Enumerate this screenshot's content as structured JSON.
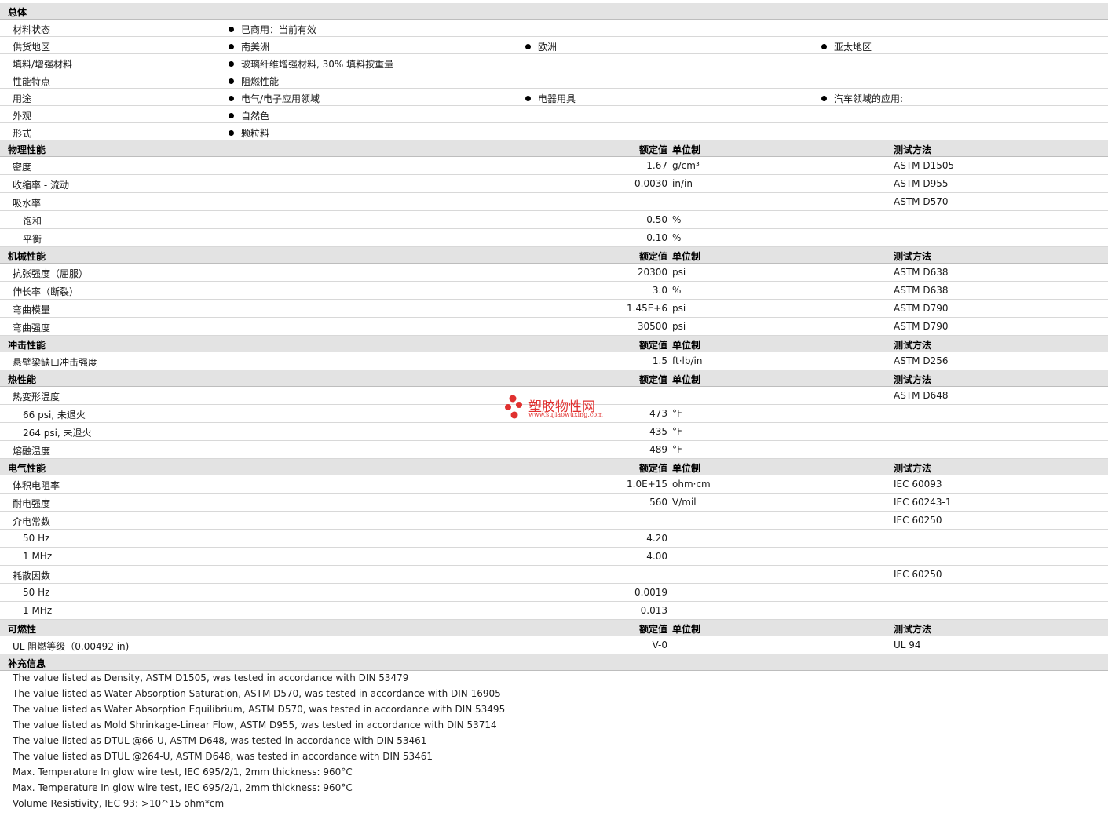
{
  "headers": {
    "value": "额定值",
    "unit": "单位制",
    "test": "测试方法"
  },
  "general": {
    "title": "总体",
    "rows": [
      {
        "label": "材料状态",
        "items": [
          "已商用：当前有效"
        ]
      },
      {
        "label": "供货地区",
        "items": [
          "南美洲",
          "欧洲",
          "亚太地区"
        ]
      },
      {
        "label": "填料/增强材料",
        "items": [
          "玻璃纤维增强材料, 30% 填料按重量"
        ]
      },
      {
        "label": "性能特点",
        "items": [
          "阻燃性能"
        ]
      },
      {
        "label": "用途",
        "items": [
          "电气/电子应用领域",
          "电器用具",
          "汽车领域的应用:"
        ]
      },
      {
        "label": "外观",
        "items": [
          "自然色"
        ]
      },
      {
        "label": "形式",
        "items": [
          "颗粒料"
        ]
      }
    ]
  },
  "physical": {
    "title": "物理性能",
    "rows": [
      {
        "label": "密度",
        "value": "1.67",
        "unit": "g/cm³",
        "test": "ASTM D1505"
      },
      {
        "label": "收缩率  - 流动",
        "value": "0.0030",
        "unit": "in/in",
        "test": "ASTM D955"
      },
      {
        "label": "吸水率",
        "value": "",
        "unit": "",
        "test": "ASTM D570"
      },
      {
        "label": "饱和",
        "value": "0.50",
        "unit": "%",
        "test": ""
      },
      {
        "label": "平衡",
        "value": "0.10",
        "unit": "%",
        "test": ""
      }
    ]
  },
  "mechanical": {
    "title": "机械性能",
    "rows": [
      {
        "label": "抗张强度（屈服）",
        "value": "20300",
        "unit": "psi",
        "test": "ASTM D638"
      },
      {
        "label": "伸长率（断裂）",
        "value": "3.0",
        "unit": "%",
        "test": "ASTM D638"
      },
      {
        "label": "弯曲模量",
        "value": "1.45E+6",
        "unit": "psi",
        "test": "ASTM D790"
      },
      {
        "label": "弯曲强度",
        "value": "30500",
        "unit": "psi",
        "test": "ASTM D790"
      }
    ]
  },
  "impact": {
    "title": "冲击性能",
    "rows": [
      {
        "label": "悬壁梁缺口冲击强度",
        "value": "1.5",
        "unit": "ft·lb/in",
        "test": "ASTM D256"
      }
    ]
  },
  "thermal": {
    "title": "热性能",
    "rows": [
      {
        "label": "热变形温度",
        "value": "",
        "unit": "",
        "test": "ASTM D648"
      },
      {
        "label": "66 psi, 未退火",
        "value": "473",
        "unit": "°F",
        "test": ""
      },
      {
        "label": "264 psi, 未退火",
        "value": "435",
        "unit": "°F",
        "test": ""
      },
      {
        "label": "熔融温度",
        "value": "489",
        "unit": "°F",
        "test": ""
      }
    ]
  },
  "electrical": {
    "title": "电气性能",
    "rows": [
      {
        "label": "体积电阻率",
        "value": "1.0E+15",
        "unit": "ohm·cm",
        "test": "IEC 60093"
      },
      {
        "label": "耐电强度",
        "value": "560",
        "unit": "V/mil",
        "test": "IEC 60243-1"
      },
      {
        "label": "介电常数",
        "value": "",
        "unit": "",
        "test": "IEC 60250"
      },
      {
        "label": "50 Hz",
        "value": "4.20",
        "unit": "",
        "test": ""
      },
      {
        "label": "1 MHz",
        "value": "4.00",
        "unit": "",
        "test": ""
      },
      {
        "label": "耗散因数",
        "value": "",
        "unit": "",
        "test": "IEC 60250"
      },
      {
        "label": "50 Hz",
        "value": "0.0019",
        "unit": "",
        "test": ""
      },
      {
        "label": "1 MHz",
        "value": "0.013",
        "unit": "",
        "test": ""
      }
    ]
  },
  "flammability": {
    "title": "可燃性",
    "rows": [
      {
        "label": "UL 阻燃等级（0.00492 in)",
        "value": "V-0",
        "unit": "",
        "test": "UL 94"
      }
    ]
  },
  "supplement": {
    "title": "补充信息",
    "notes": [
      "The value listed as Density, ASTM D1505, was tested in accordance with DIN 53479",
      "The value listed as Water Absorption Saturation, ASTM D570, was tested in accordance with DIN 16905",
      "The value listed as Water Absorption Equilibrium, ASTM D570, was tested in accordance with DIN 53495",
      "The value listed as Mold Shrinkage-Linear Flow, ASTM D955, was tested in accordance with DIN 53714",
      "The value listed as DTUL @66-U, ASTM D648, was tested in accordance with DIN 53461",
      "The value listed as DTUL @264-U, ASTM D648, was tested in accordance with DIN 53461",
      "Max. Temperature In glow wire test, IEC 695/2/1, 2mm thickness: 960°C",
      "Max. Temperature In glow wire test, IEC 695/2/1, 2mm thickness: 960°C",
      "Volume Resistivity, IEC 93: >10^15 ohm*cm"
    ]
  },
  "watermark": {
    "title": "塑胶物性网",
    "url": "www.sujiaowuxing.com",
    "color": "#e0302f"
  }
}
